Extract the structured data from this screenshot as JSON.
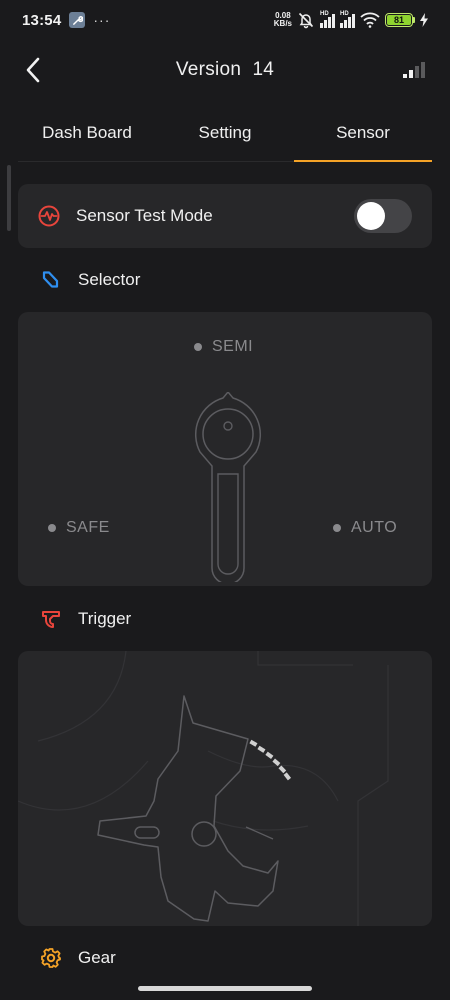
{
  "status_bar": {
    "time": "13:54",
    "dots": "···",
    "net_speed_value": "0.08",
    "net_speed_unit": "KB/s",
    "battery_level": "81",
    "network_1": "HD",
    "network_2": "HD"
  },
  "header": {
    "title": "Version  14"
  },
  "tabs": [
    {
      "label": "Dash Board"
    },
    {
      "label": "Setting"
    },
    {
      "label": "Sensor",
      "active": true
    }
  ],
  "sensor_test_mode": {
    "label": "Sensor Test Mode",
    "enabled": false
  },
  "selector": {
    "label": "Selector",
    "positions": {
      "semi": "SEMI",
      "safe": "SAFE",
      "auto": "AUTO"
    }
  },
  "trigger": {
    "label": "Trigger"
  },
  "gear": {
    "label": "Gear"
  },
  "colors": {
    "accent": "#f5a327",
    "background": "#1a1a1c",
    "card": "#272729",
    "test_mode_icon": "#e8453c",
    "selector_icon": "#2f8ff0",
    "trigger_icon": "#e8453c",
    "gear_icon": "#f5a327"
  },
  "icons": {
    "back": "chevron-left-icon",
    "signal": "signal-bars-icon",
    "test_mode": "heartbeat-icon",
    "selector": "selector-icon",
    "trigger": "trigger-icon",
    "gear": "gear-icon"
  }
}
